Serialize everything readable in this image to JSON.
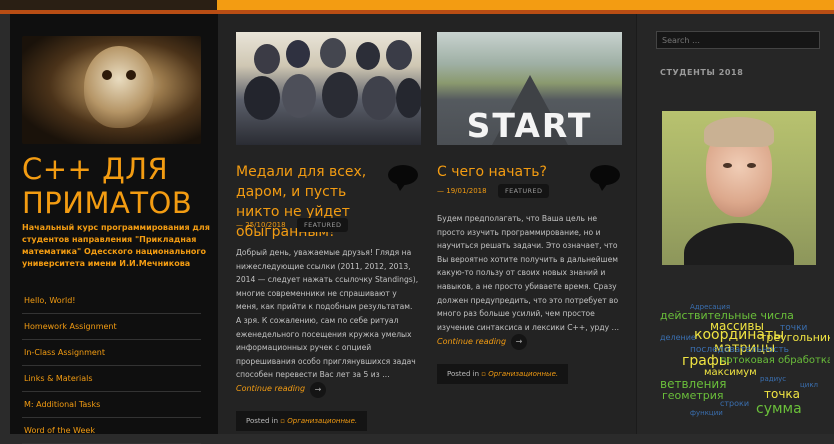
{
  "site": {
    "title": "C++ ДЛЯ ПРИМАТОВ",
    "description": "Начальный курс программирования для студентов направления \"Прикладная математика\" Одесского национального университета имени И.И.Мечникова"
  },
  "nav": {
    "items": [
      {
        "label": "Hello, World!"
      },
      {
        "label": "Homework Assignment"
      },
      {
        "label": "In-Class Assignment"
      },
      {
        "label": "Links & Materials"
      },
      {
        "label": "M: Additional Tasks"
      },
      {
        "label": "Word of the Week"
      }
    ]
  },
  "posts": [
    {
      "title": "Медали для всех, даром, и пусть никто не уйдет обыгранным!",
      "date": "25/10/2018",
      "tag": "FEATURED",
      "excerpt": "Добрый день, уважаемые друзья! Глядя на нижеследующие ссылки (2011, 2012, 2013, 2014 — следует нажать ссылочку Standings), многие современники не спрашивают у меня, как прийти к подобным результатам. А зря. К сожалению, сам по себе ритуал еженедельного посещения кружка умелых информационных ручек с опцией прорешивания особо приглянувшихся задач способен перевести Вас лет за 5 из …",
      "continue": "Continue reading",
      "posted_in": "Posted in",
      "category": "Организационные."
    },
    {
      "title": "С чего начать?",
      "date": "19/01/2018",
      "tag": "FEATURED",
      "image_text": "START",
      "excerpt": "Будем предполагать, что Ваша цель не просто изучить программирование, но и научиться решать задачи. Это означает, что Вы вероятно хотите получить в дальнейшем какую-то пользу от своих новых знаний и навыков, а не просто убиваете время. Сразу должен предупредить, что это потребует во много раз больше усилий, чем простое изучение синтаксиса и лексики C++, урду …",
      "continue": "Continue reading",
      "posted_in": "Posted in",
      "category": "Организационные."
    }
  ],
  "sidebar": {
    "search_placeholder": "Search …",
    "widget_title": "СТУДЕНТЫ 2018"
  },
  "tag_cloud": [
    {
      "text": "Адресация",
      "color": "#3a6fb0",
      "size": 7
    },
    {
      "text": "действительные числа",
      "color": "#6abf3a",
      "size": 11
    },
    {
      "text": "массивы",
      "color": "#f0e442",
      "size": 12
    },
    {
      "text": "координаты",
      "color": "#f0e442",
      "size": 14
    },
    {
      "text": "точки",
      "color": "#3a6fb0",
      "size": 9
    },
    {
      "text": "деление",
      "color": "#3a6fb0",
      "size": 8
    },
    {
      "text": "треугольник",
      "color": "#f0e442",
      "size": 11
    },
    {
      "text": "матрицы",
      "color": "#f0e442",
      "size": 13
    },
    {
      "text": "последовательность",
      "color": "#3a6fb0",
      "size": 9
    },
    {
      "text": "графы",
      "color": "#f0e442",
      "size": 14
    },
    {
      "text": "потоковая обработка",
      "color": "#6abf3a",
      "size": 10
    },
    {
      "text": "максимум",
      "color": "#f0e442",
      "size": 10
    },
    {
      "text": "радиус",
      "color": "#3a6fb0",
      "size": 7
    },
    {
      "text": "ветвления",
      "color": "#6abf3a",
      "size": 12
    },
    {
      "text": "цикл",
      "color": "#3a6fb0",
      "size": 7
    },
    {
      "text": "геометрия",
      "color": "#6abf3a",
      "size": 11
    },
    {
      "text": "точка",
      "color": "#f0e442",
      "size": 12
    },
    {
      "text": "сумма",
      "color": "#6abf3a",
      "size": 14
    },
    {
      "text": "строки",
      "color": "#3a6fb0",
      "size": 8
    },
    {
      "text": "функции",
      "color": "#3a6fb0",
      "size": 7
    }
  ]
}
